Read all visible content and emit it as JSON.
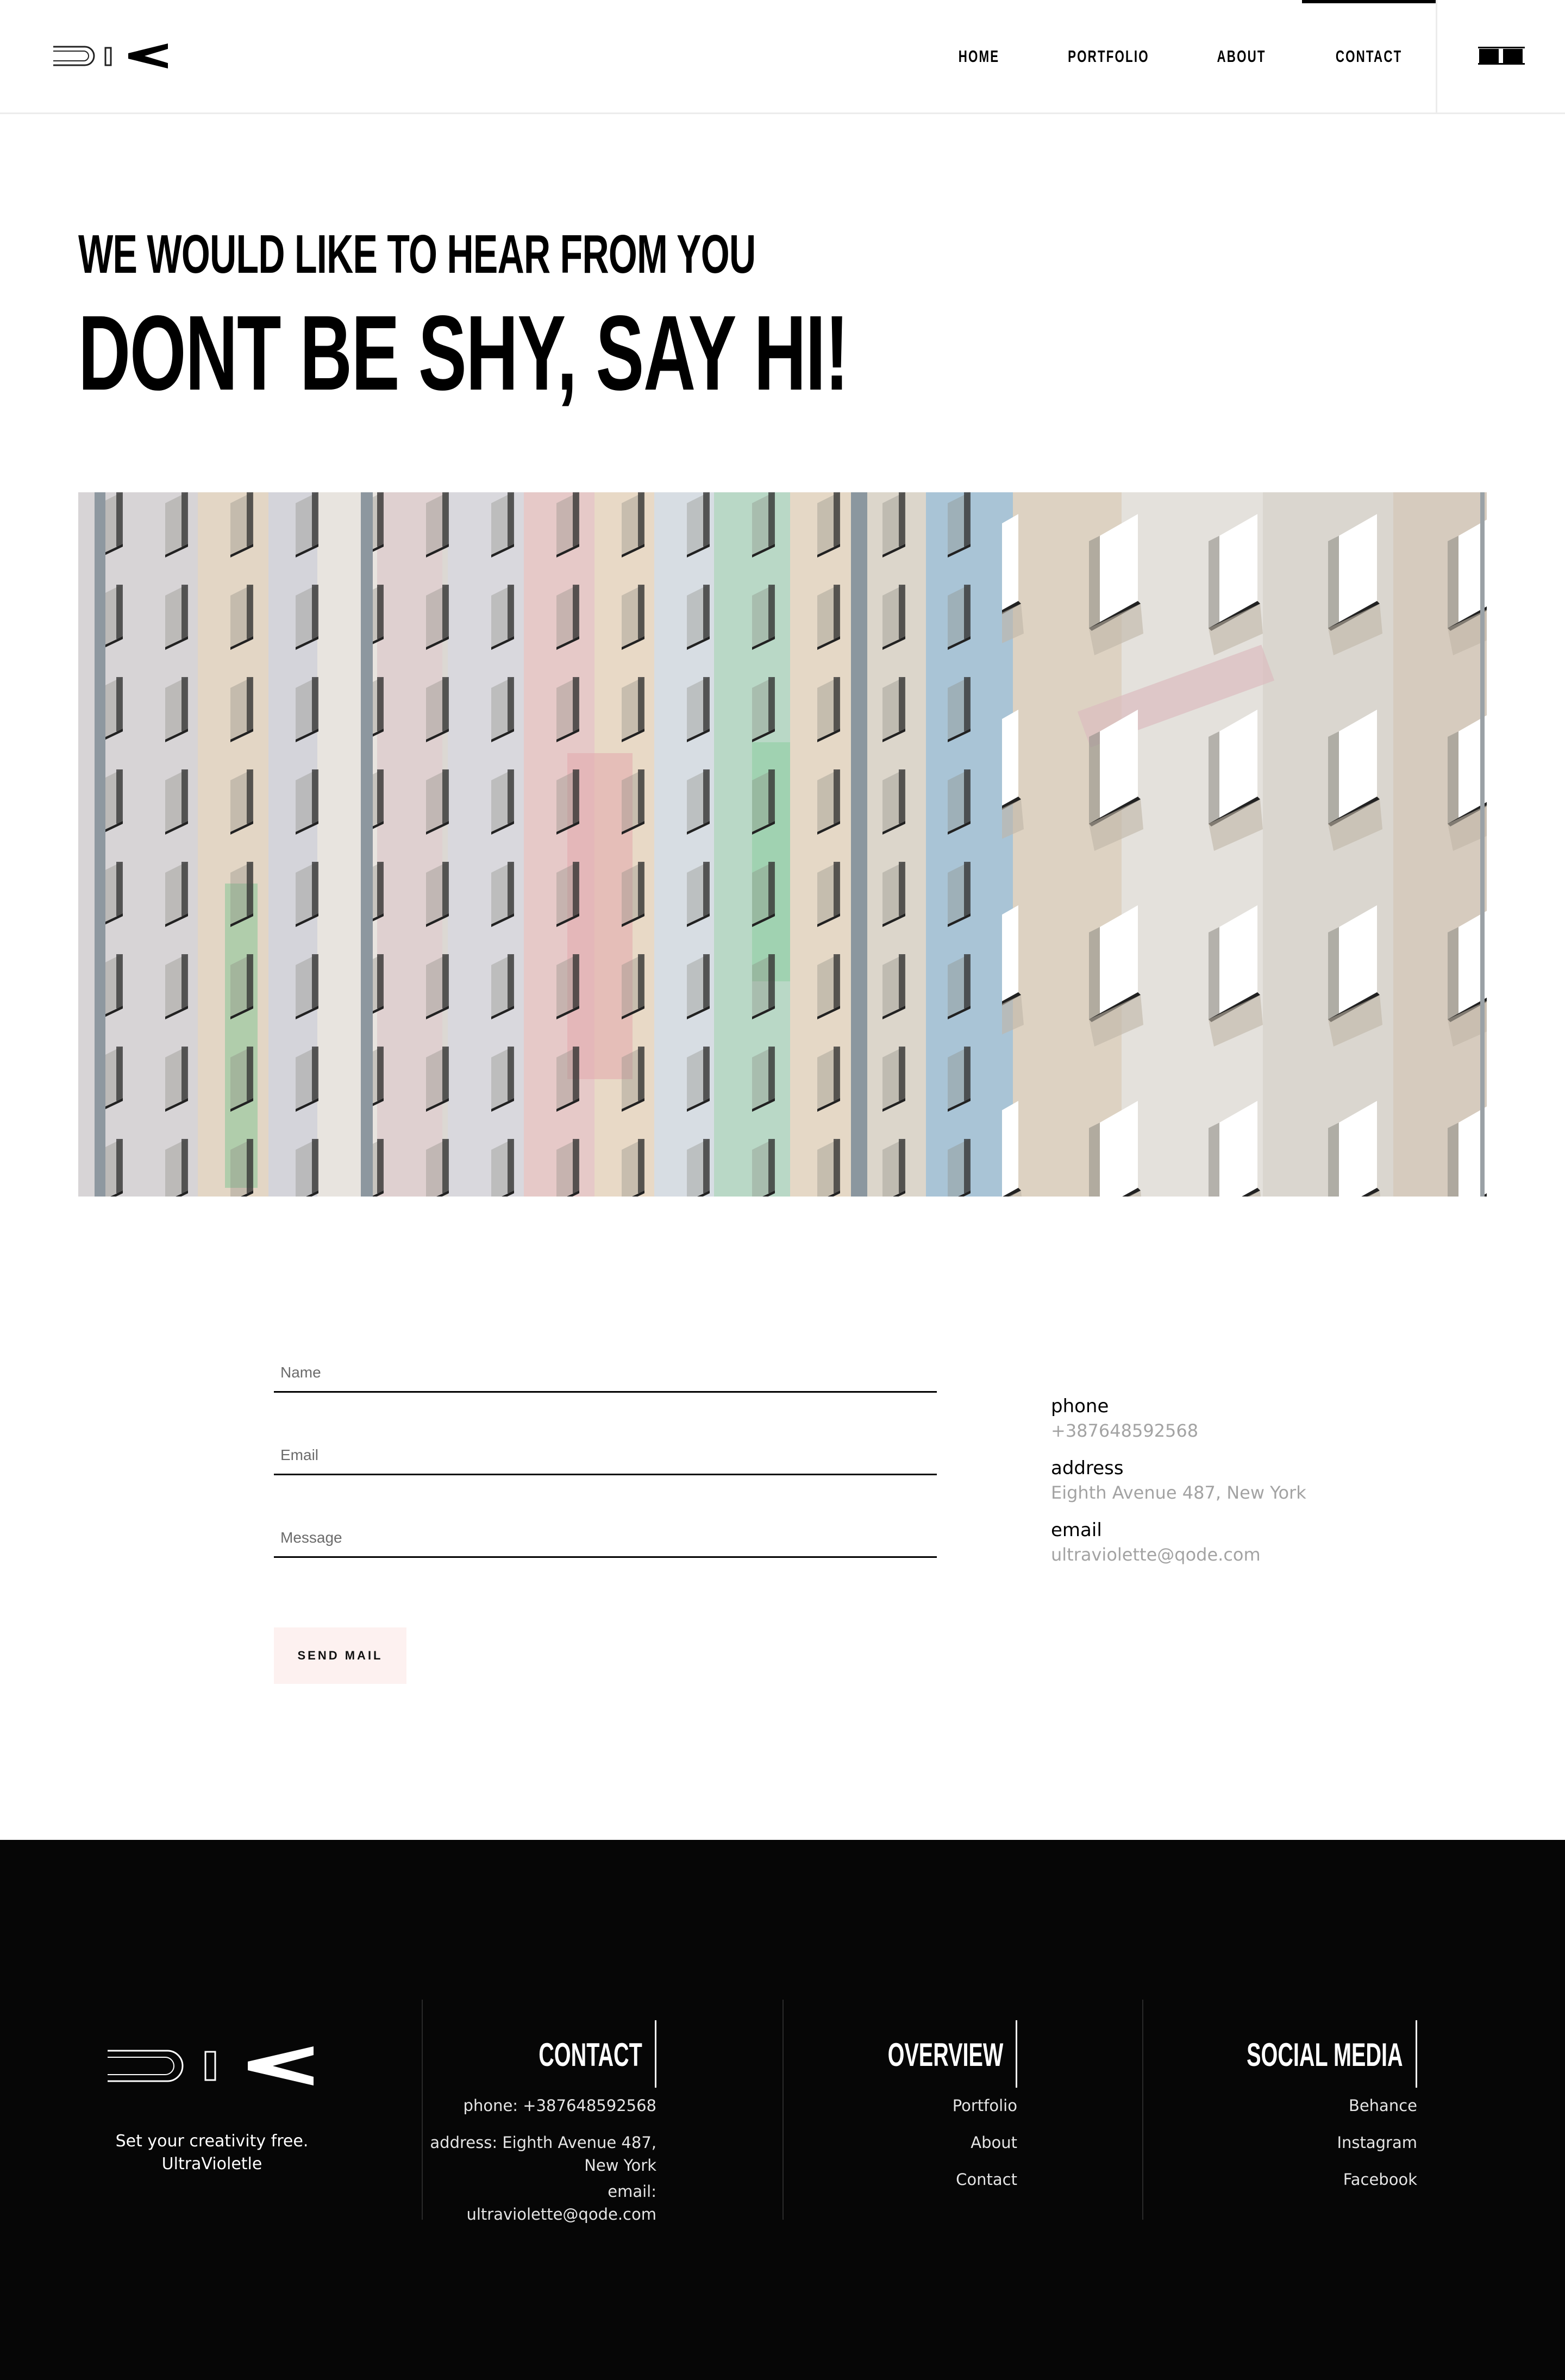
{
  "nav": {
    "items": [
      {
        "label": "HOME"
      },
      {
        "label": "PORTFOLIO"
      },
      {
        "label": "ABOUT"
      },
      {
        "label": "CONTACT"
      }
    ],
    "active": "CONTACT"
  },
  "hero": {
    "subtitle": "WE WOULD LIKE TO HEAR FROM YOU",
    "title": "DONT BE SHY, SAY HI!"
  },
  "form": {
    "name_placeholder": "Name",
    "email_placeholder": "Email",
    "message_placeholder": "Message",
    "send_label": "SEND MAIL"
  },
  "contact_info": {
    "phone_label": "phone",
    "phone_value": "+387648592568",
    "address_label": "address",
    "address_value": "Eighth Avenue 487, New York",
    "email_label": "email",
    "email_value": "ultraviolette@qode.com"
  },
  "footer": {
    "tagline_line1": "Set your creativity free.",
    "tagline_line2": "UltraVioletle",
    "contact": {
      "heading": "CONTACT",
      "phone": "phone: +387648592568",
      "address_line1": "address: Eighth Avenue 487,",
      "address_line2": "New York",
      "email": "email: ultraviolette@qode.com"
    },
    "overview": {
      "heading": "OVERVIEW",
      "links": [
        "Portfolio",
        "About",
        "Contact"
      ]
    },
    "social": {
      "heading": "SOCIAL MEDIA",
      "links": [
        "Behance",
        "Instagram",
        "Facebook"
      ]
    }
  },
  "colors": {
    "accent_button_bg": "#fdf1f0",
    "footer_bg": "#060606",
    "muted_text": "#a3a3a3"
  }
}
